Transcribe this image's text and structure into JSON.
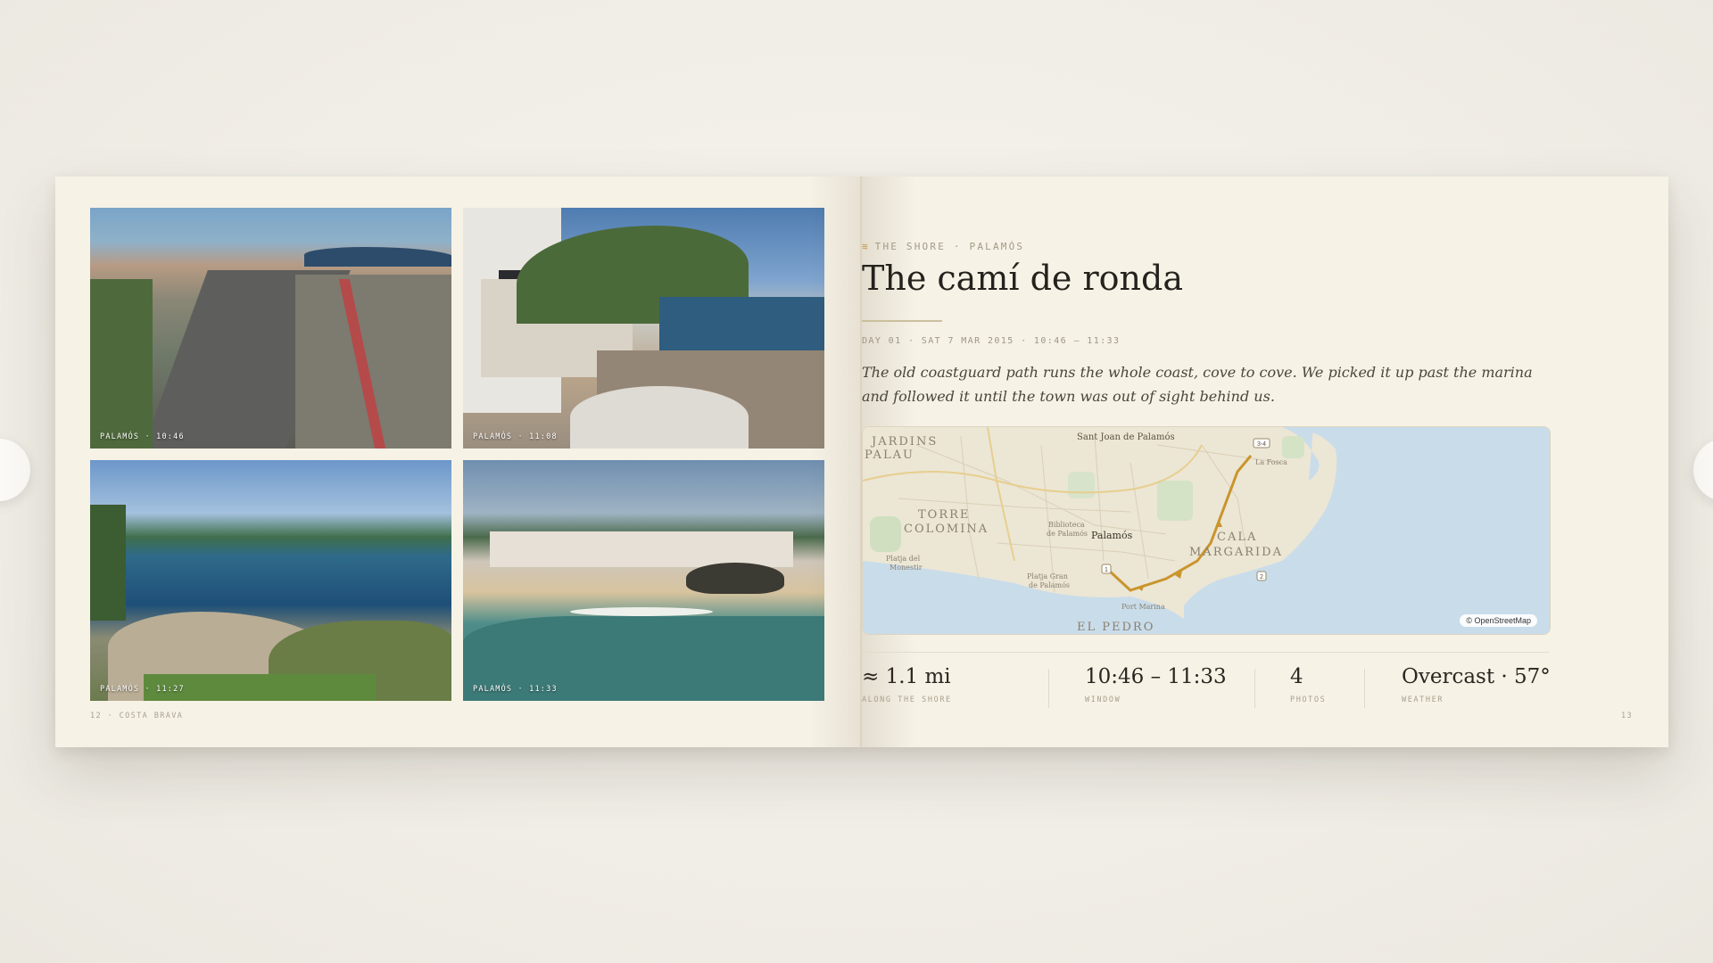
{
  "photos": [
    {
      "caption": "PALAMÓS · 10:46"
    },
    {
      "caption": "PALAMÓS · 11:08"
    },
    {
      "caption": "PALAMÓS · 11:27"
    },
    {
      "caption": "PALAMÓS · 11:33"
    }
  ],
  "left_folio": "12 · COSTA BRAVA",
  "right_folio": "13",
  "section": {
    "eyebrow": "THE SHORE · PALAMÓS",
    "title": "The camí de ronda",
    "meta": "DAY 01 · SAT 7 MAR 2015 · 10:46 – 11:33",
    "lede": "The old coastguard path runs the whole coast, cove to cove. We picked it up past the marina and followed it until the town was out of sight behind us."
  },
  "map": {
    "attribution": "© OpenStreetMap",
    "labels": {
      "jardins": "JARDINS",
      "palau": "PALAU",
      "sant_joan": "Sant Joan de Palamós",
      "torre": "TORRE",
      "colomina": "COLOMINA",
      "biblioteca": "Biblioteca",
      "de_palamos": "de Palamós",
      "palamos": "Palamós",
      "cala": "CALA",
      "margarida": "MARGARIDA",
      "platja_mon": "Platja del",
      "monestir": "Monestir",
      "platja_gran": "Platja Gran",
      "de_palamos2": "de Palamós",
      "port_marina": "Port Marina",
      "el_pedro": "EL PEDRO",
      "la_fosca": "La Fosca"
    },
    "markers": [
      "1",
      "2",
      "3-4"
    ]
  },
  "stats": [
    {
      "value": "≈ 1.1 mi",
      "label": "ALONG THE SHORE"
    },
    {
      "value": "10:46 – 11:33",
      "label": "WINDOW"
    },
    {
      "value": "4",
      "label": "PHOTOS"
    },
    {
      "value": "Overcast · 57°",
      "label": "WEATHER"
    }
  ],
  "nav": {
    "prev": "‹",
    "next": "›"
  },
  "colors": {
    "page": "#f6f2e6",
    "route": "#c9952c",
    "water": "#c9dcea",
    "land": "#ece6d5"
  }
}
